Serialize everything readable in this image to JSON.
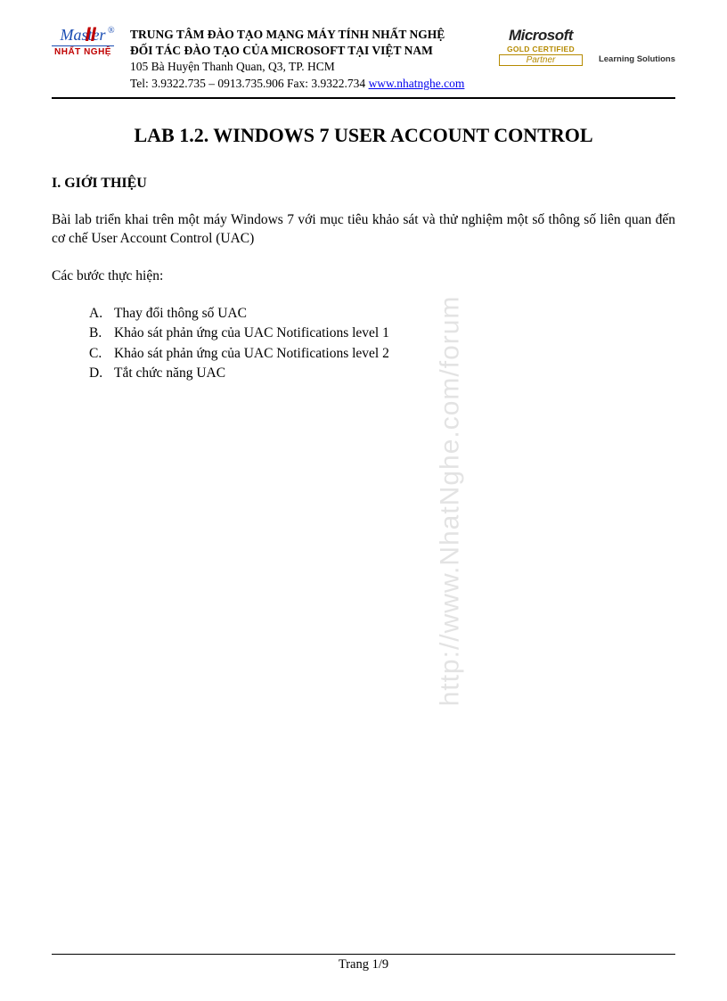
{
  "header": {
    "logo": {
      "top_text": "Master",
      "roman": "II",
      "reg": "®",
      "bottom_text": "NHẤT NGHỆ"
    },
    "org": {
      "line1": "TRUNG TÂM ĐÀO TẠO MẠNG MÁY TÍNH NHẤT NGHỆ",
      "line2": "ĐỐI TÁC ĐÀO TẠO CỦA MICROSOFT TẠI VIỆT NAM",
      "address": "105 Bà Huyện Thanh Quan, Q3, TP. HCM",
      "contact_prefix": "Tel: 3.9322.735 – 0913.735.906 Fax: 3.9322.734   ",
      "link_text": "www.nhatnghe.com"
    },
    "partner": {
      "ms": "Microsoft",
      "gold": "GOLD CERTIFIED",
      "partner": "Partner"
    },
    "learning": "Learning Solutions"
  },
  "title": "LAB 1.2. WINDOWS 7 USER ACCOUNT CONTROL",
  "section_heading": "I. GIỚI THIỆU",
  "intro": "Bài lab triển khai trên một máy Windows 7 với mục tiêu khảo sát và thử nghiệm một số thông số liên quan đến cơ chế User Account Control (UAC)",
  "steps_label": "Các bước thực hiện:",
  "steps": [
    {
      "marker": "A.",
      "text": "Thay đổi thông số UAC"
    },
    {
      "marker": "B.",
      "text": "Khảo sát phản ứng của UAC Notifications level 1"
    },
    {
      "marker": "C.",
      "text": "Khảo sát phản ứng của UAC Notifications level 2"
    },
    {
      "marker": "D.",
      "text": "Tắt chức năng UAC"
    }
  ],
  "watermark": "http://www.NhatNghe.com/forum",
  "footer": "Trang 1/9"
}
